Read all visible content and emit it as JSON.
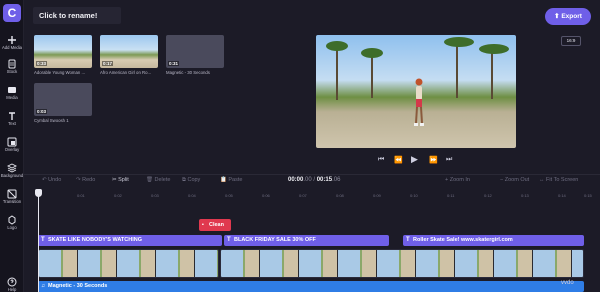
{
  "app": {
    "logo": "C",
    "project_title": "Click to rename!",
    "export_label": "Export",
    "aspect_ratio": "16:9",
    "watermark": "vvdo"
  },
  "sidebar": {
    "items": [
      {
        "label": "Add Media",
        "icon": "plus-icon"
      },
      {
        "label": "Stock",
        "icon": "stock-icon"
      },
      {
        "label": "Media",
        "icon": "media-icon"
      },
      {
        "label": "Text",
        "icon": "text-icon"
      },
      {
        "label": "Overlay",
        "icon": "overlay-icon"
      },
      {
        "label": "Background",
        "icon": "background-icon"
      },
      {
        "label": "Transition",
        "icon": "transition-icon"
      },
      {
        "label": "Logo",
        "icon": "logo-icon"
      },
      {
        "label": "Help",
        "icon": "help-icon"
      }
    ]
  },
  "media": [
    {
      "duration": "0:33",
      "caption": "Adorable Young Woman ..."
    },
    {
      "duration": "0:17",
      "caption": "Afro American Girl on Ro..."
    },
    {
      "duration": "0:31",
      "caption": "Magnetic - 30 Seconds"
    },
    {
      "duration": "0:03",
      "caption": "Cymbal Swoosh 1"
    }
  ],
  "toolbar": {
    "undo": "Undo",
    "redo": "Redo",
    "split": "Split",
    "delete": "Delete",
    "copy": "Copy",
    "paste": "Paste",
    "time_current": "00:00",
    "time_current_frac": ".00",
    "time_sep": "/",
    "time_total": "00:15",
    "time_total_frac": ".06",
    "zoom_in": "Zoom In",
    "zoom_out": "Zoom Out",
    "fit": "Fit To Screen"
  },
  "ruler": [
    "0:01",
    "0:02",
    "0:03",
    "0:04",
    "0:05",
    "0:06",
    "0:07",
    "0:08",
    "0:09",
    "0:10",
    "0:11",
    "0:12",
    "0:13",
    "0:14",
    "0:15"
  ],
  "timeline": {
    "clean_label": "Clean",
    "text_tracks": [
      "SKATE LIKE NOBODY'S WATCHING",
      "BLACK FRIDAY SALE 30% OFF",
      "Roller Skate Sale! www.skatergirl.com"
    ],
    "audio_track": "Magnetic - 30 Seconds"
  }
}
